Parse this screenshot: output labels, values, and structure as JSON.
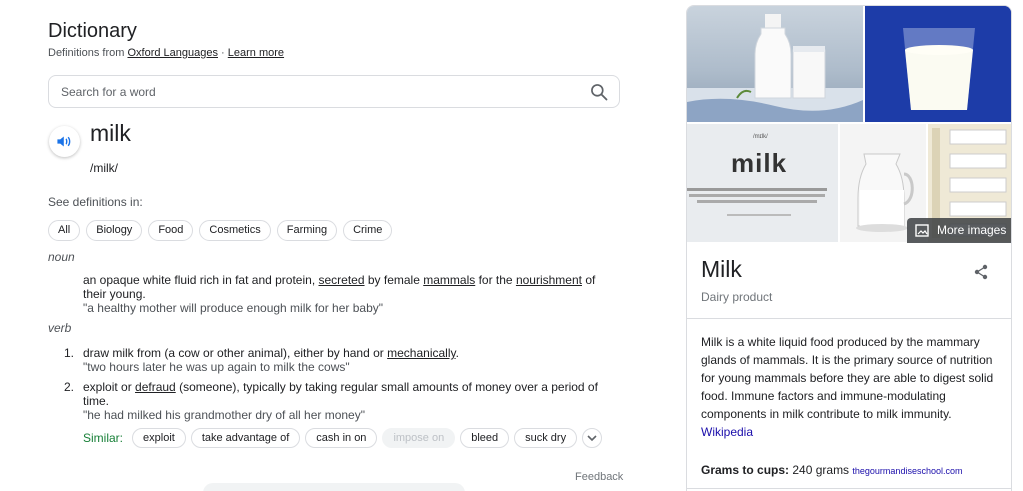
{
  "dictionary": {
    "title": "Dictionary",
    "source_prefix": "Definitions from ",
    "source_link": "Oxford Languages",
    "source_sep": " · ",
    "learn_more": "Learn more",
    "search": {
      "placeholder": "Search for a word",
      "icon": "search-icon"
    },
    "word": "milk",
    "phonetic": "/milk/",
    "see_definitions": "See definitions in:",
    "categories": [
      "All",
      "Biology",
      "Food",
      "Cosmetics",
      "Farming",
      "Crime"
    ],
    "noun": {
      "label": "noun",
      "definition": {
        "before": "an opaque white fluid rich in fat and protein, ",
        "link1": "secreted",
        "mid1": " by female ",
        "link2": "mammals",
        "mid2": " for the ",
        "link3": "nourishment",
        "after": " of their young.",
        "example": "\"a healthy mother will produce enough milk for her baby\""
      }
    },
    "verb": {
      "label": "verb",
      "definitions": [
        {
          "num": "1.",
          "before": "draw milk from (a cow or other animal), either by hand or ",
          "link": "mechanically",
          "after": ".",
          "example": "\"two hours later he was up again to milk the cows\""
        },
        {
          "num": "2.",
          "before": "exploit or ",
          "link": "defraud",
          "after": " (someone), typically by taking regular small amounts of money over a period of time.",
          "example": "\"he had milked his grandmother dry of all her money\""
        }
      ]
    },
    "similar_label": "Similar:",
    "similar": [
      "exploit",
      "take advantage of",
      "cash in on",
      "impose on",
      "bleed",
      "suck dry"
    ],
    "feedback": "Feedback"
  },
  "knowledge_panel": {
    "more_images": "More images",
    "title": "Milk",
    "subtitle": "Dairy product",
    "description": "Milk is a white liquid food produced by the mammary glands of mammals. It is the primary source of nutrition for young mammals before they are able to digest solid food. Immune factors and immune-modulating components in milk contribute to milk immunity. ",
    "description_link": "Wikipedia",
    "fact_label": "Grams to cups:",
    "fact_value": " 240 grams ",
    "fact_source": "thegourmandiseschool.com",
    "image3_word": "milk",
    "image3_phonetic": "/mɪlk/"
  },
  "colors": {
    "accent_blue": "#1a73e8",
    "link": "#1a0dab",
    "similar_green": "#188038"
  }
}
